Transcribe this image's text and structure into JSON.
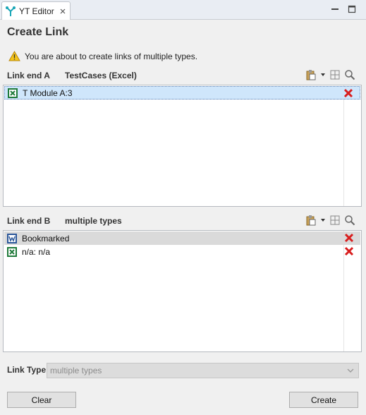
{
  "tab": {
    "label": "YT Editor"
  },
  "panel": {
    "title": "Create Link",
    "warning": "You are about to create links of multiple types."
  },
  "link_end_a": {
    "label": "Link end A",
    "value": "TestCases (Excel)",
    "items": [
      {
        "text": "T Module A:3",
        "icon": "excel-icon"
      }
    ]
  },
  "link_end_b": {
    "label": "Link end B",
    "value": "multiple types",
    "items": [
      {
        "text": "Bookmarked",
        "icon": "word-icon"
      },
      {
        "text": "n/a: n/a",
        "icon": "excel-icon"
      }
    ]
  },
  "link_type": {
    "label": "Link Type",
    "value": "multiple types"
  },
  "buttons": {
    "clear": "Clear",
    "create": "Create"
  },
  "colors": {
    "selection": "#cfe6fb",
    "delete": "#d81e1e",
    "excel": "#1f7a3a",
    "word": "#2b579a"
  }
}
